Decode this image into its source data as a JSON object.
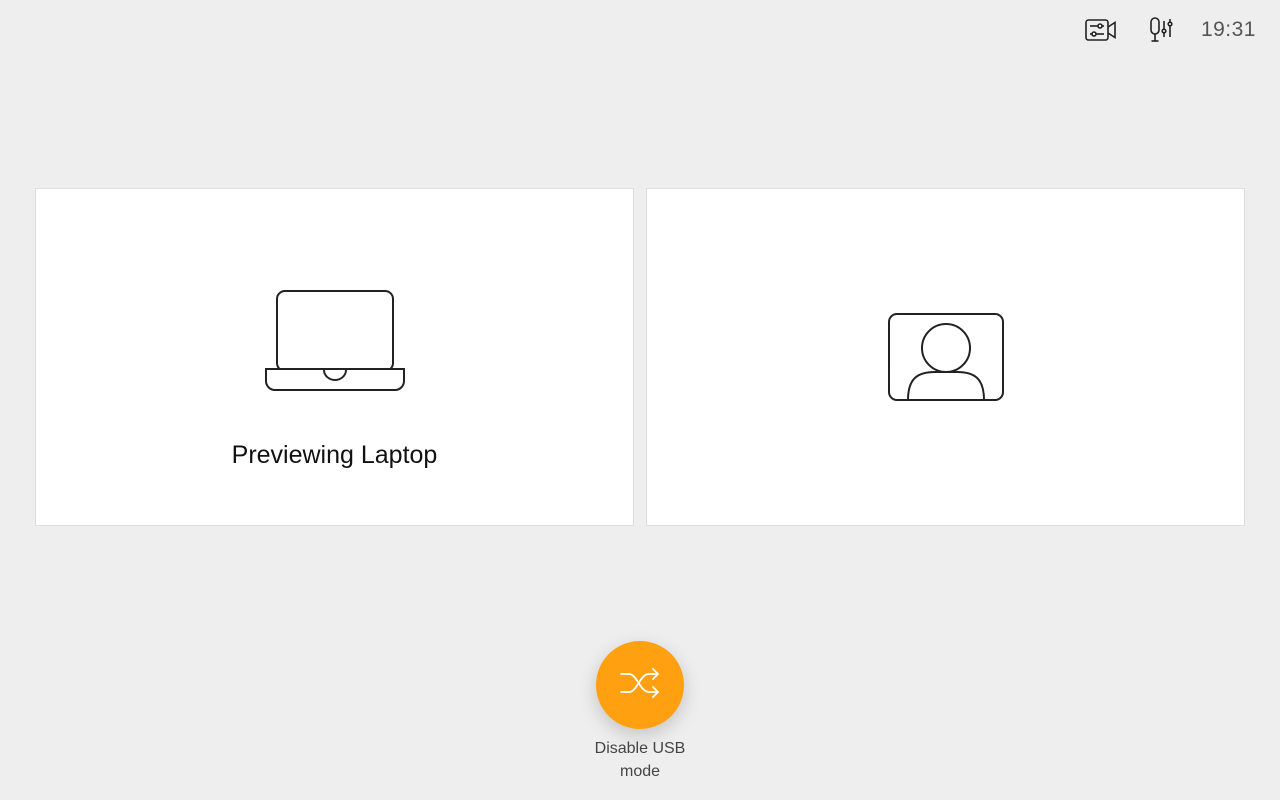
{
  "status_bar": {
    "clock": "19:31",
    "icons": [
      "camera-settings-icon",
      "mic-settings-icon"
    ]
  },
  "panels": {
    "left": {
      "icon": "laptop-icon",
      "label": "Previewing Laptop"
    },
    "right": {
      "icon": "person-icon"
    }
  },
  "usb_button": {
    "icon": "shuffle-icon",
    "label": "Disable USB mode",
    "color": "#ffa010"
  },
  "colors": {
    "background": "#eeeeee",
    "panel": "#ffffff",
    "accent": "#ffa010"
  }
}
